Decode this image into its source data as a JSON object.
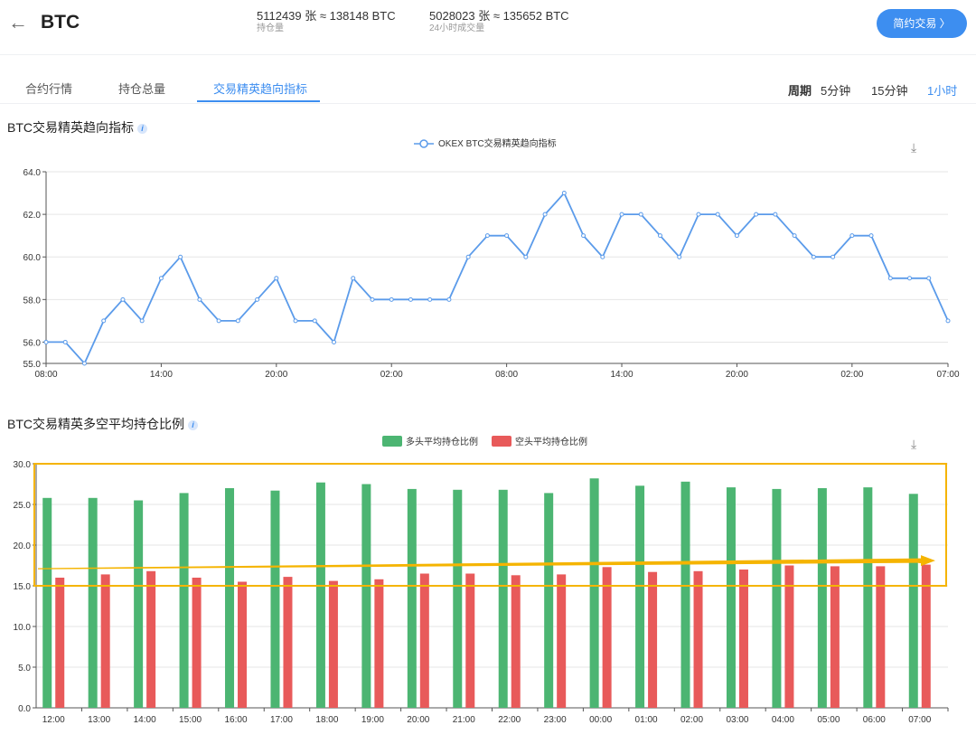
{
  "header": {
    "back_icon": "arrow-left-icon",
    "symbol": "BTC",
    "open_interest_value": "5112439 张 ≈ 138148 BTC",
    "open_interest_label": "持仓量",
    "volume_value": "5028023 张 ≈ 135652 BTC",
    "volume_label": "24小时成交量",
    "trade_button": "简约交易 〉"
  },
  "tabs": [
    {
      "label": "合约行情",
      "active": false
    },
    {
      "label": "持仓总量",
      "active": false
    },
    {
      "label": "交易精英趋向指标",
      "active": true
    }
  ],
  "period": {
    "label": "周期",
    "options": [
      {
        "label": "5分钟",
        "active": false
      },
      {
        "label": "15分钟",
        "active": false
      },
      {
        "label": "1小时",
        "active": true
      }
    ]
  },
  "colors": {
    "accent": "#3d8ef0",
    "line": "#5b9bea",
    "long": "#4cb572",
    "short": "#e85a5a",
    "annotation": "#f5b400"
  },
  "chart1_title": "BTC交易精英趋向指标",
  "chart2_title": "BTC交易精英多空平均持仓比例",
  "chart_data": [
    {
      "type": "line",
      "title": "BTC交易精英趋向指标",
      "legend": "OKEX BTC交易精英趋向指标",
      "ylim": [
        55,
        64
      ],
      "yticks": [
        "64.0",
        "62.0",
        "60.0",
        "58.0",
        "56.0",
        "55.0"
      ],
      "xticks": [
        "08:00",
        "14:00",
        "20:00",
        "02:00",
        "08:00",
        "14:00",
        "20:00",
        "02:00",
        "07:00"
      ],
      "values": [
        56,
        56,
        55,
        57,
        58,
        57,
        59,
        60,
        58,
        57,
        57,
        58,
        59,
        57,
        57,
        56,
        59,
        58,
        58,
        58,
        58,
        58,
        60,
        61,
        61,
        60,
        62,
        63,
        61,
        60,
        62,
        62,
        61,
        60,
        62,
        62,
        61,
        62,
        62,
        61,
        60,
        60,
        61,
        61,
        59,
        59,
        59,
        57
      ]
    },
    {
      "type": "bar",
      "title": "BTC交易精英多空平均持仓比例",
      "legend": [
        "多头平均持仓比例",
        "空头平均持仓比例"
      ],
      "ylim": [
        0,
        30
      ],
      "yticks": [
        "30.0",
        "25.0",
        "20.0",
        "15.0",
        "10.0",
        "5.0",
        "0.0"
      ],
      "categories": [
        "12:00",
        "13:00",
        "14:00",
        "15:00",
        "16:00",
        "17:00",
        "18:00",
        "19:00",
        "20:00",
        "21:00",
        "22:00",
        "23:00",
        "00:00",
        "01:00",
        "02:00",
        "03:00",
        "04:00",
        "05:00",
        "06:00",
        "07:00"
      ],
      "series": [
        {
          "name": "多头平均持仓比例",
          "values": [
            25.8,
            25.8,
            25.5,
            26.4,
            27.0,
            26.7,
            27.7,
            27.5,
            26.9,
            26.8,
            26.8,
            26.4,
            28.2,
            27.3,
            27.8,
            27.1,
            26.9,
            27.0,
            27.1,
            26.3
          ]
        },
        {
          "name": "空头平均持仓比例",
          "values": [
            16.0,
            16.4,
            16.8,
            16.0,
            15.5,
            16.1,
            15.6,
            15.8,
            16.5,
            16.5,
            16.3,
            16.4,
            17.3,
            16.7,
            16.8,
            17.0,
            17.5,
            17.4,
            17.4,
            17.6
          ]
        }
      ]
    }
  ]
}
